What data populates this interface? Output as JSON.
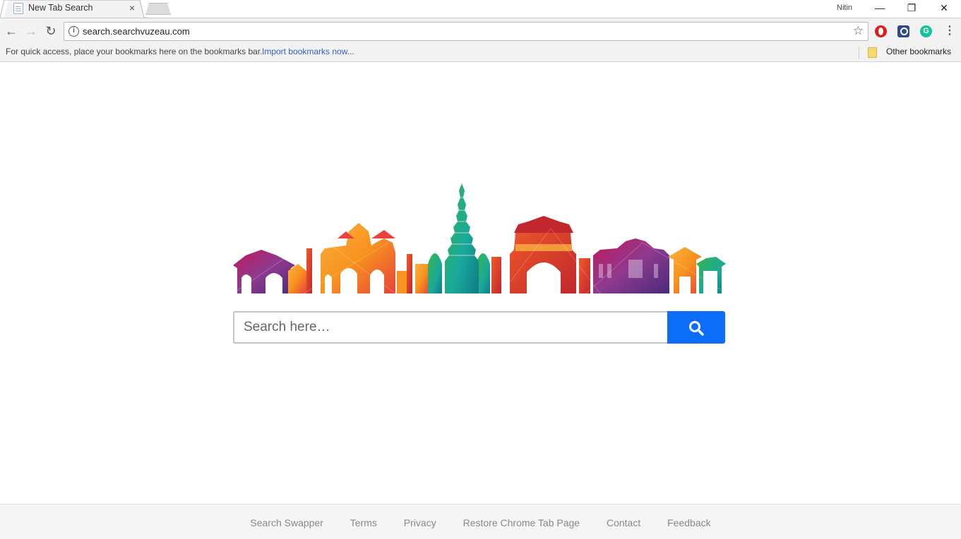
{
  "window": {
    "profile_name": "Nitin",
    "minimize_glyph": "—",
    "maximize_glyph": "❐",
    "close_glyph": "✕"
  },
  "tab": {
    "title": "New Tab Search",
    "close_glyph": "×"
  },
  "toolbar": {
    "back_glyph": "←",
    "forward_glyph": "→",
    "reload_glyph": "↻",
    "url": "search.searchvuzeau.com",
    "info_glyph": "i",
    "star_glyph": "☆",
    "menu_glyph": "⋮",
    "extensions": [
      "opera-icon",
      "search-extension-icon",
      "grammarly-icon"
    ],
    "grammarly_letter": "G"
  },
  "bookmarks": {
    "hint": "For quick access, place your bookmarks here on the bookmarks bar.",
    "import_link": "Import bookmarks now...",
    "other": "Other bookmarks"
  },
  "search": {
    "placeholder": "Search here…",
    "button_color": "#0d6dfb"
  },
  "footer": {
    "links": [
      "Search Swapper",
      "Terms",
      "Privacy",
      "Restore Chrome Tab Page",
      "Contact",
      "Feedback"
    ]
  },
  "colors": {
    "accent_blue": "#0d6dfb",
    "link_blue": "#2a5fc9",
    "skyline_orange": "#f7931e",
    "skyline_red": "#e8423a",
    "skyline_teal": "#1aa99a",
    "skyline_purple": "#8e3a8f"
  }
}
